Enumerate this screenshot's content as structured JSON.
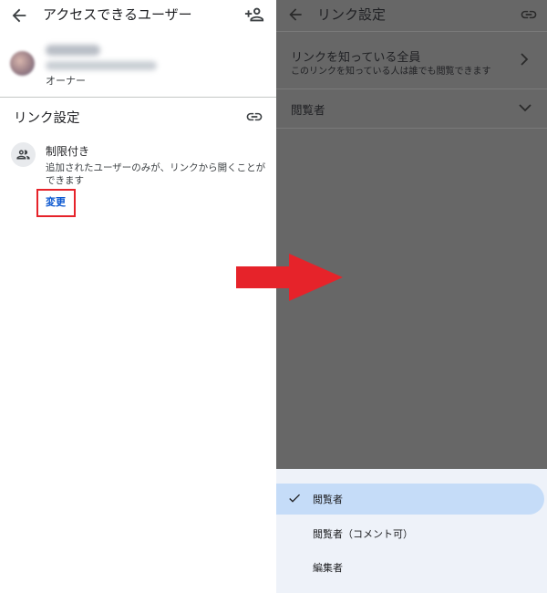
{
  "left_panel": {
    "title": "アクセスできるユーザー",
    "owner_role": "オーナー",
    "section_title": "リンク設定",
    "access_level": "制限付き",
    "access_description": "追加されたユーザーのみが、リンクから開くことができます",
    "change_label": "変更"
  },
  "right_panel": {
    "title": "リンク設定",
    "general_access": {
      "title": "リンクを知っている全員",
      "subtitle": "このリンクを知っている人は誰でも閲覧できます"
    },
    "role_selected": "閲覧者",
    "role_options": [
      {
        "label": "閲覧者",
        "selected": true
      },
      {
        "label": "閲覧者（コメント可）",
        "selected": false
      },
      {
        "label": "編集者",
        "selected": false
      }
    ]
  },
  "icons": [
    "back-arrow-icon",
    "person-add-icon",
    "link-icon",
    "people-icon",
    "chevron-right-icon",
    "chevron-down-icon",
    "check-icon"
  ],
  "colors": {
    "highlight_box": "#e6232a",
    "arrow": "#e6232a",
    "link_blue": "#0b57d0",
    "overlay": "#676767",
    "selected_option": "#c5dcf8",
    "sheet_bg": "#eef2f9"
  }
}
